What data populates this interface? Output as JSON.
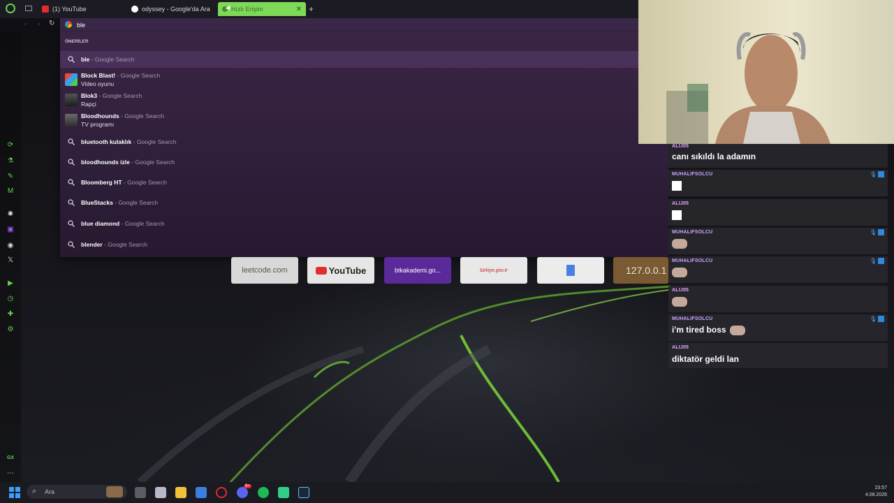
{
  "tabs": [
    {
      "label": "(1) YouTube"
    },
    {
      "label": "odyssey - Google'da Ara"
    },
    {
      "label": "Hızlı Erişim"
    }
  ],
  "address": {
    "value": "ble"
  },
  "suggestions": {
    "header": "ÖNERİLER",
    "items": [
      {
        "bold": "ble",
        "source": " - Google Search"
      },
      {
        "bold": "Block Blast!",
        "source": " - Google Search",
        "sub": "Video oyunu"
      },
      {
        "bold": "Blok3",
        "source": " - Google Search",
        "sub": "Rapçi"
      },
      {
        "bold": "Bloodhounds",
        "source": " - Google Search",
        "sub": "TV programı"
      },
      {
        "bold": "bluetooth kulaklık",
        "source": " - Google Search"
      },
      {
        "bold": "bloodhounds izle",
        "source": " - Google Search"
      },
      {
        "bold": "Bloomberg HT",
        "source": " - Google Search"
      },
      {
        "bold": "BlueStacks",
        "source": " - Google Search"
      },
      {
        "bold": "blue diamond",
        "source": " - Google Search"
      },
      {
        "bold": "blender",
        "source": " - Google Search"
      }
    ]
  },
  "speed_dial": [
    {
      "label": "leetcode.com"
    },
    {
      "label": "YouTube"
    },
    {
      "label": "btkakademi.go..."
    },
    {
      "label": "türkiye.gov.tr"
    },
    {
      "label": ""
    },
    {
      "label": "127.0.0.1"
    }
  ],
  "chat": [
    {
      "user": "ALIJ05",
      "text": "canı sıkıldı la adamın",
      "color": "#e6a8ff"
    },
    {
      "user": "MUHALIFSOLCU",
      "text": "",
      "color": "#c9a6ff"
    },
    {
      "user": "ALIJ05",
      "text": "",
      "color": "#e6a8ff"
    },
    {
      "user": "MUHALIFSOLCU",
      "text": "",
      "color": "#c9a6ff"
    },
    {
      "user": "MUHALIFSOLCU",
      "text": "",
      "color": "#c9a6ff"
    },
    {
      "user": "ALIJ05",
      "text": "",
      "color": "#e6a8ff"
    },
    {
      "user": "MUHALIFSOLCU",
      "text": "i'm tired boss",
      "color": "#c9a6ff"
    },
    {
      "user": "ALIJ05",
      "text": "diktatör geldi lan",
      "color": "#e6a8ff"
    }
  ],
  "taskbar": {
    "search_placeholder": "Ara",
    "time": "23:57",
    "date": "4.08.2026",
    "discord_badge": "9+"
  },
  "sidebar": {
    "gx_label": "GX"
  },
  "colors": {
    "accent_green": "#6ce33a",
    "tab_active": "#7ed957"
  }
}
